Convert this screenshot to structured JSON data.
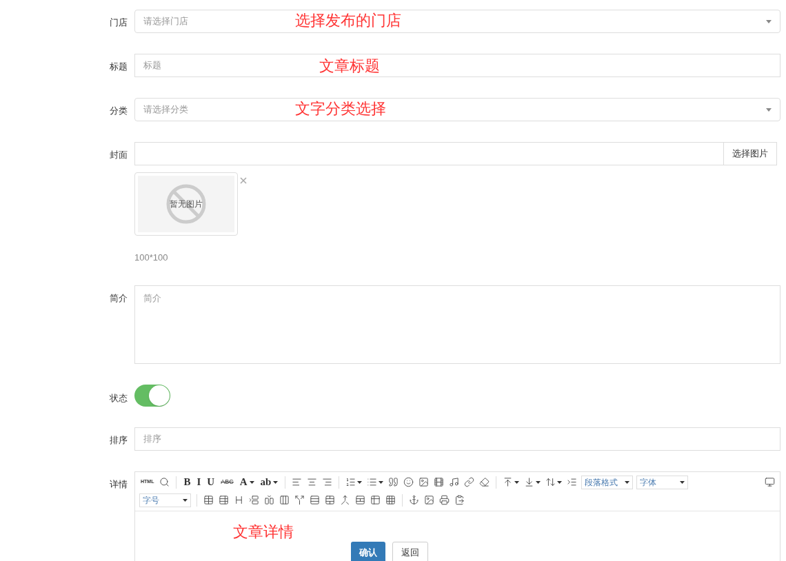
{
  "fields": [
    {
      "kind": "select",
      "label": "门店",
      "placeholder": "请选择门店",
      "annotation": "选择发布的门店"
    },
    {
      "kind": "input",
      "label": "标题",
      "placeholder": "标题",
      "annotation": "文章标题"
    },
    {
      "kind": "select",
      "label": "分类",
      "placeholder": "请选择分类",
      "annotation": "文字分类选择"
    },
    {
      "kind": "image",
      "label": "封面",
      "button": "选择图片",
      "image_text": "暂无图片",
      "size_hint": "100*100"
    },
    {
      "kind": "textarea",
      "label": "简介",
      "placeholder": "简介"
    },
    {
      "kind": "switch",
      "label": "状态",
      "on": true
    },
    {
      "kind": "input",
      "label": "排序",
      "placeholder": "排序"
    },
    {
      "kind": "editor",
      "label": "详情",
      "annotation": "文章详情"
    }
  ],
  "editor_toolbar": {
    "rows": [
      [
        {
          "kind": "text",
          "label": "HTML"
        },
        {
          "kind": "icon"
        },
        {
          "kind": "sep"
        },
        {
          "kind": "text",
          "label": "B"
        },
        {
          "kind": "text",
          "label": "I"
        },
        {
          "kind": "text",
          "label": "U"
        },
        {
          "kind": "text",
          "label": "ABC"
        },
        {
          "kind": "text",
          "label": "A",
          "caret": true
        },
        {
          "kind": "text",
          "label": "ab",
          "caret": true
        },
        {
          "kind": "sep"
        },
        {
          "kind": "icon"
        },
        {
          "kind": "icon"
        },
        {
          "kind": "icon"
        },
        {
          "kind": "sep"
        },
        {
          "kind": "icon",
          "caret": true
        },
        {
          "kind": "icon",
          "caret": true
        },
        {
          "kind": "icon"
        },
        {
          "kind": "icon"
        },
        {
          "kind": "icon"
        },
        {
          "kind": "icon"
        },
        {
          "kind": "icon"
        },
        {
          "kind": "icon"
        },
        {
          "kind": "icon"
        },
        {
          "kind": "sep"
        },
        {
          "kind": "icon",
          "caret": true
        },
        {
          "kind": "icon",
          "caret": true
        },
        {
          "kind": "icon",
          "caret": true
        },
        {
          "kind": "icon"
        },
        {
          "kind": "dropdown",
          "label": "段落格式"
        },
        {
          "kind": "dropdown",
          "label": "字体"
        },
        {
          "kind": "spacer"
        },
        {
          "kind": "icon"
        }
      ],
      [
        {
          "kind": "dropdown",
          "label": "字号"
        },
        {
          "kind": "sep"
        },
        {
          "kind": "icon"
        },
        {
          "kind": "icon"
        },
        {
          "kind": "icon"
        },
        {
          "kind": "icon"
        },
        {
          "kind": "icon"
        },
        {
          "kind": "icon"
        },
        {
          "kind": "icon"
        },
        {
          "kind": "icon"
        },
        {
          "kind": "icon"
        },
        {
          "kind": "icon"
        },
        {
          "kind": "icon"
        },
        {
          "kind": "icon"
        },
        {
          "kind": "icon"
        },
        {
          "kind": "sep"
        },
        {
          "kind": "icon"
        },
        {
          "kind": "icon"
        },
        {
          "kind": "icon"
        },
        {
          "kind": "icon"
        }
      ]
    ]
  },
  "buttons": [
    {
      "label": "确认",
      "kind": "primary"
    },
    {
      "label": "返回",
      "kind": "default"
    }
  ]
}
